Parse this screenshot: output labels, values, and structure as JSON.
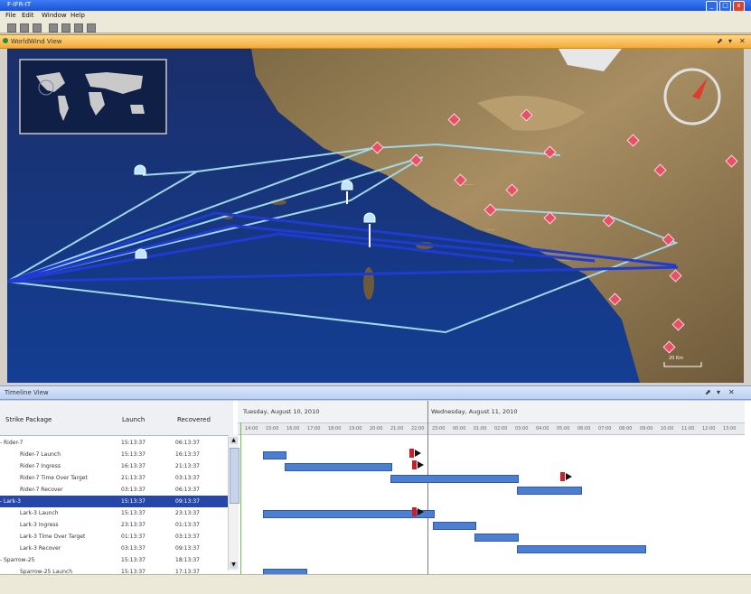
{
  "window": {
    "title": "F-IFR-IT"
  },
  "menu": [
    "File",
    "Edit",
    "Window",
    "Help"
  ],
  "worldwind_panel": {
    "title": "WorldWind View",
    "controls": [
      "⬈",
      "▾",
      "✕"
    ]
  },
  "map": {
    "scale_label": "20 Km"
  },
  "timeline_panel": {
    "title": "Timeline View",
    "controls": [
      "⬈",
      "▾",
      "✕"
    ]
  },
  "grid": {
    "headers": {
      "package": "Strike Package",
      "launch": "Launch",
      "recovered": "Recovered"
    },
    "rows": [
      {
        "name": "Rider-7",
        "launch": "15:13:37",
        "recovered": "06:13:37",
        "level": 0
      },
      {
        "name": "Rider-7 Launch",
        "launch": "15:13:37",
        "recovered": "16:13:37",
        "level": 1
      },
      {
        "name": "Rider-7 Ingress",
        "launch": "16:13:37",
        "recovered": "21:13:37",
        "level": 1
      },
      {
        "name": "Rider-7 Time Over Target",
        "launch": "21:13:37",
        "recovered": "03:13:37",
        "level": 1
      },
      {
        "name": "Rider-7 Recover",
        "launch": "03:13:37",
        "recovered": "06:13:37",
        "level": 1
      },
      {
        "name": "Lark-3",
        "launch": "15:13:37",
        "recovered": "09:13:37",
        "level": 0,
        "selected": true
      },
      {
        "name": "Lark-3 Launch",
        "launch": "15:13:37",
        "recovered": "23:13:37",
        "level": 1
      },
      {
        "name": "Lark-3 Ingress",
        "launch": "23:13:37",
        "recovered": "01:13:37",
        "level": 1
      },
      {
        "name": "Lark-3 Time Over Target",
        "launch": "01:13:37",
        "recovered": "03:13:37",
        "level": 1
      },
      {
        "name": "Lark-3 Recover",
        "launch": "03:13:37",
        "recovered": "09:13:37",
        "level": 1
      },
      {
        "name": "Sparrow-25",
        "launch": "15:13:37",
        "recovered": "18:13:37",
        "level": 0
      },
      {
        "name": "Sparrow-25 Launch",
        "launch": "15:13:37",
        "recovered": "17:13:37",
        "level": 1
      }
    ]
  },
  "gantt": {
    "days": [
      "Tuesday, August 10, 2010",
      "Wednesday, August 11, 2010"
    ],
    "hours": [
      "14:00",
      "15:00",
      "16:00",
      "17:00",
      "18:00",
      "19:00",
      "20:00",
      "21:00",
      "22:00",
      "23:00",
      "00:00",
      "01:00",
      "02:00",
      "03:00",
      "04:00",
      "05:00",
      "06:00",
      "07:00",
      "08:00",
      "09:00",
      "10:00",
      "11:00",
      "12:00",
      "13:00"
    ]
  },
  "colors": {
    "accent": "#f6a936",
    "bar": "#4c7fd1",
    "selection": "#2646a8",
    "marker": "#e8506a",
    "flight_path": "#9fd8e8"
  }
}
